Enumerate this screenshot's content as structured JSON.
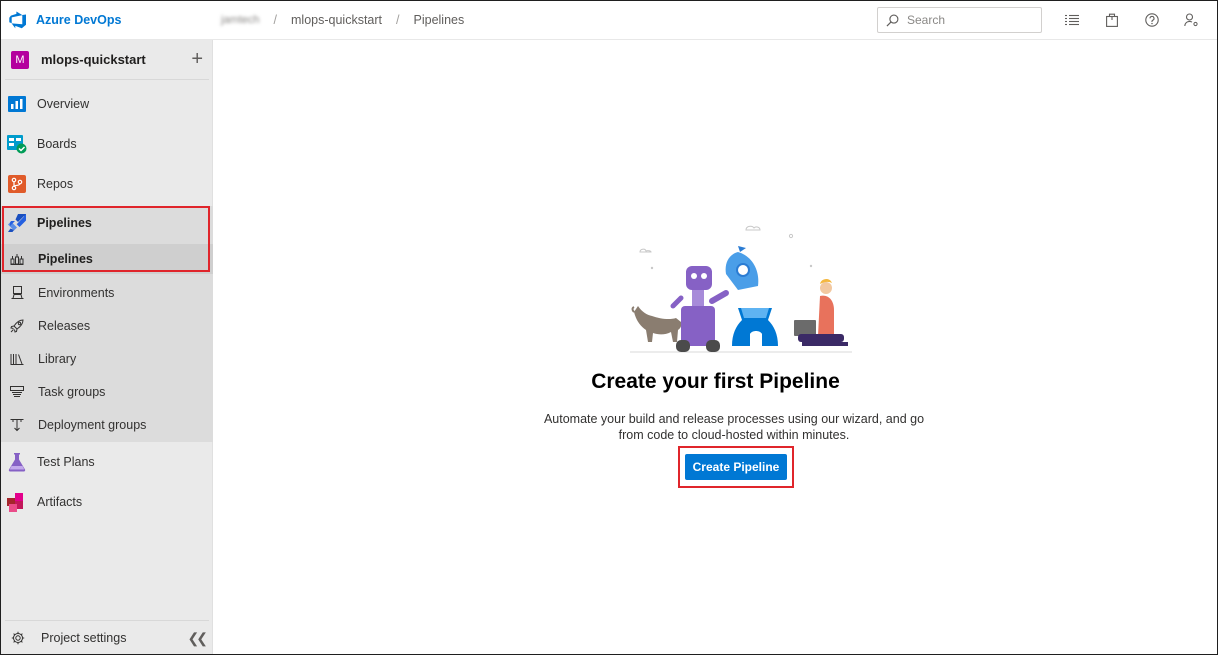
{
  "app": {
    "name": "Azure DevOps"
  },
  "breadcrumb": {
    "org": "jamtech",
    "project": "mlops-quickstart",
    "page": "Pipelines"
  },
  "search": {
    "placeholder": "Search"
  },
  "sidebar": {
    "project_initial": "M",
    "project_name": "mlops-quickstart",
    "items": [
      {
        "label": "Overview",
        "icon": "overview-icon"
      },
      {
        "label": "Boards",
        "icon": "boards-icon"
      },
      {
        "label": "Repos",
        "icon": "repos-icon"
      },
      {
        "label": "Pipelines",
        "icon": "pipelines-icon"
      },
      {
        "label": "Test Plans",
        "icon": "test-plans-icon"
      },
      {
        "label": "Artifacts",
        "icon": "artifacts-icon"
      }
    ],
    "pipeline_subitems": [
      {
        "label": "Pipelines",
        "icon": "pipelines-sub-icon"
      },
      {
        "label": "Environments",
        "icon": "environments-icon"
      },
      {
        "label": "Releases",
        "icon": "releases-icon"
      },
      {
        "label": "Library",
        "icon": "library-icon"
      },
      {
        "label": "Task groups",
        "icon": "task-groups-icon"
      },
      {
        "label": "Deployment groups",
        "icon": "deployment-groups-icon"
      }
    ],
    "footer_label": "Project settings"
  },
  "main": {
    "title": "Create your first Pipeline",
    "description": "Automate your build and release processes using our wizard, and go from code to cloud-hosted within minutes.",
    "cta_label": "Create Pipeline"
  },
  "colors": {
    "brand": "#0078d4",
    "highlight": "#e0252b",
    "project_avatar": "#b4009e"
  }
}
